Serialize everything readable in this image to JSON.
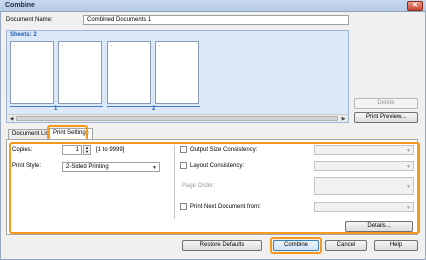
{
  "window": {
    "title": "Combine"
  },
  "document": {
    "name_label": "Document Name:",
    "name_value": "Combined Documents 1"
  },
  "sheets": {
    "label": "Sheets: 2",
    "numbers": [
      "1",
      "2"
    ]
  },
  "side_buttons": {
    "delete": "Delete",
    "print_preview": "Print Preview..."
  },
  "tabs": [
    {
      "label": "Document List"
    },
    {
      "label": "Print Settings"
    }
  ],
  "settings": {
    "copies_label": "Copies:",
    "copies_value": "1",
    "copies_range": "[1 to 9999]",
    "print_style_label": "Print Style:",
    "print_style_value": "2-Sided Printing",
    "output_size_label": "Output Size Consistency:",
    "layout_label": "Layout Consistency:",
    "page_order_label": "Page Order:",
    "print_next_label": "Print Next Document from:",
    "details_button": "Details..."
  },
  "footer": {
    "restore_defaults": "Restore Defaults",
    "combine": "Combine",
    "cancel": "Cancel",
    "help": "Help"
  },
  "colors": {
    "highlight": "#f39a1e",
    "sheets_bg": "#dbe8f7",
    "accent_text": "#1f5fb5"
  }
}
